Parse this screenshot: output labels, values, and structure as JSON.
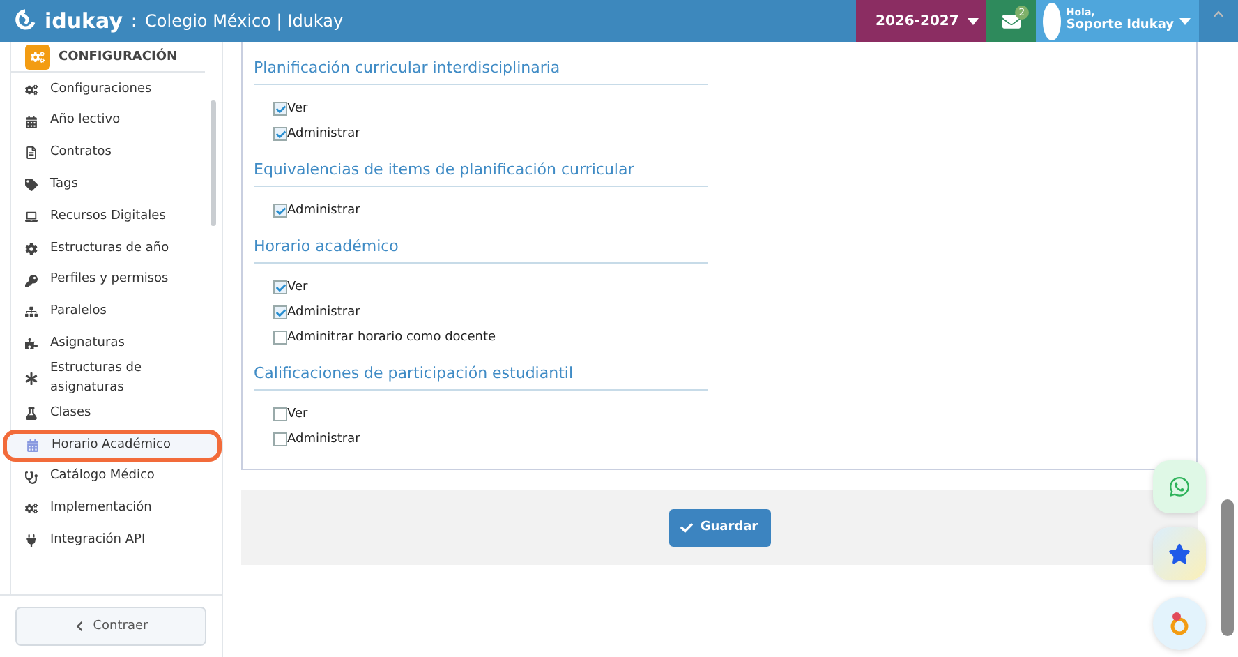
{
  "header": {
    "logo": "idukay",
    "separator": ":",
    "title": "Colegio México | Idukay",
    "year": "2026-2027",
    "messages_count": "2",
    "greeting": "Hola,",
    "user": "Soporte Idukay"
  },
  "sidebar": {
    "section": "CONFIGURACIÓN",
    "items": [
      {
        "label": "Configuraciones",
        "selected": false
      },
      {
        "label": "Año lectivo",
        "selected": false
      },
      {
        "label": "Contratos",
        "selected": false
      },
      {
        "label": "Tags",
        "selected": false
      },
      {
        "label": "Recursos Digitales",
        "selected": false
      },
      {
        "label": "Estructuras de año",
        "selected": false
      },
      {
        "label": "Perfiles y permisos",
        "selected": false
      },
      {
        "label": "Paralelos",
        "selected": false
      },
      {
        "label": "Asignaturas",
        "selected": false
      },
      {
        "label": "Estructuras de asignaturas",
        "selected": false
      },
      {
        "label": "Clases",
        "selected": false
      },
      {
        "label": "Horario Académico",
        "selected": true
      },
      {
        "label": "Catálogo Médico",
        "selected": false
      },
      {
        "label": "Implementación",
        "selected": false
      },
      {
        "label": "Integración API",
        "selected": false
      }
    ],
    "collapse_button": "Contraer"
  },
  "sections": [
    {
      "title": "Planificación curricular interdisciplinaria",
      "permissions": [
        {
          "label": "Ver",
          "checked": true
        },
        {
          "label": "Administrar",
          "checked": true
        }
      ]
    },
    {
      "title": "Equivalencias de items de planificación curricular",
      "permissions": [
        {
          "label": "Administrar",
          "checked": true
        }
      ]
    },
    {
      "title": "Horario académico",
      "permissions": [
        {
          "label": "Ver",
          "checked": true
        },
        {
          "label": "Administrar",
          "checked": true
        },
        {
          "label": "Adminitrar horario como docente",
          "checked": false
        }
      ]
    },
    {
      "title": "Calificaciones de participación estudiantil",
      "permissions": [
        {
          "label": "Ver",
          "checked": false
        },
        {
          "label": "Administrar",
          "checked": false
        }
      ]
    }
  ],
  "save_button": "Guardar"
}
